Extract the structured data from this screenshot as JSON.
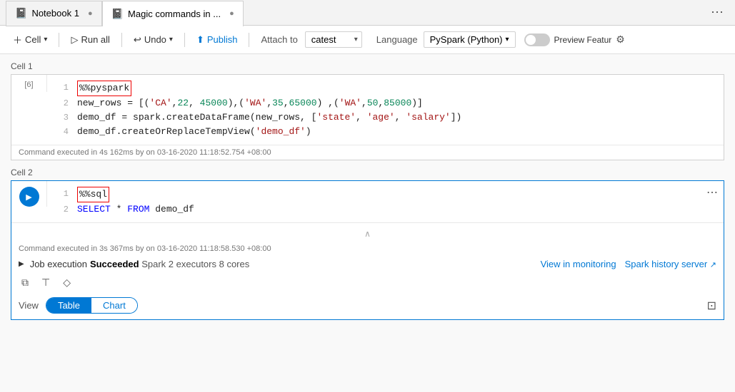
{
  "tabs": [
    {
      "id": "notebook1",
      "label": "Notebook 1",
      "active": false,
      "icon": "📓"
    },
    {
      "id": "magic-commands",
      "label": "Magic commands in ...",
      "active": true,
      "icon": "📓"
    }
  ],
  "toolbar": {
    "cell_label": "Cell",
    "run_all_label": "Run all",
    "undo_label": "Undo",
    "publish_label": "Publish",
    "attach_to_label": "Attach to",
    "attach_to_value": "catest",
    "language_label": "Language",
    "language_value": "PySpark (Python)",
    "preview_label": "Preview Featur"
  },
  "cell1": {
    "label": "Cell 1",
    "exec_num": "[6]",
    "lines": [
      {
        "num": "1",
        "code": "%%pyspark",
        "type": "magic"
      },
      {
        "num": "2",
        "code": "new_rows = [('CA',22, 45000),('WA',35,65000) ,('WA',50,85000)]",
        "type": "code"
      },
      {
        "num": "3",
        "code": "demo_df = spark.createDataFrame(new_rows, ['state', 'age', 'salary'])",
        "type": "code"
      },
      {
        "num": "4",
        "code": "demo_df.createOrReplaceTempView('demo_df')",
        "type": "code"
      }
    ],
    "footer": "Command executed in 4s 162ms by    on 03-16-2020 11:18:52.754 +08:00"
  },
  "cell2": {
    "label": "Cell 2",
    "lines": [
      {
        "num": "1",
        "code": "%%sql",
        "type": "magic"
      },
      {
        "num": "2",
        "code": "SELECT * FROM demo_df",
        "type": "sql"
      }
    ],
    "footer": "Command executed in 3s 367ms by    on 03-16-2020 11:18:58.530 +08:00",
    "job": {
      "status": "Succeeded",
      "spark_info": "Spark 2 executors 8 cores",
      "view_monitoring_label": "View in monitoring",
      "spark_history_label": "Spark history server"
    },
    "view": {
      "label": "View",
      "table_label": "Table",
      "chart_label": "Chart"
    }
  }
}
